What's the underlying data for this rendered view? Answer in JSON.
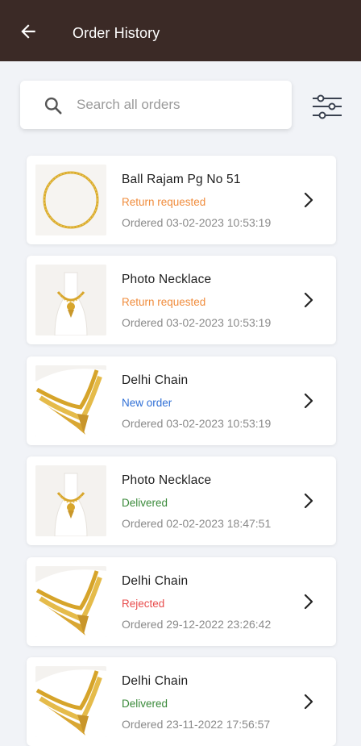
{
  "header": {
    "title": "Order History",
    "back_icon": "arrow-left-icon"
  },
  "search": {
    "placeholder": "Search all orders",
    "value": "",
    "icon": "search-icon"
  },
  "filter": {
    "icon": "sliders-filter-icon"
  },
  "status_colors": {
    "Return requested": "#f08c3c",
    "New order": "#2f6fd6",
    "Delivered": "#3a8a3a",
    "Rejected": "#e84c4c"
  },
  "orders": [
    {
      "name": "Ball Rajam Pg No 51",
      "status": "Return requested",
      "date": "Ordered 03-02-2023 10:53:19",
      "image": "round-gold-chain"
    },
    {
      "name": "Photo Necklace",
      "status": "Return requested",
      "date": "Ordered 03-02-2023 10:53:19",
      "image": "photo-necklace-on-bust"
    },
    {
      "name": "Delhi Chain",
      "status": "New order",
      "date": "Ordered 03-02-2023 10:53:19",
      "image": "gold-choker-on-bust"
    },
    {
      "name": "Photo Necklace",
      "status": "Delivered",
      "date": "Ordered 02-02-2023 18:47:51",
      "image": "photo-necklace-on-bust"
    },
    {
      "name": "Delhi Chain",
      "status": "Rejected",
      "date": "Ordered 29-12-2022 23:26:42",
      "image": "gold-choker-on-bust"
    },
    {
      "name": "Delhi Chain",
      "status": "Delivered",
      "date": "Ordered 23-11-2022 17:56:57",
      "image": "gold-choker-on-bust"
    }
  ]
}
